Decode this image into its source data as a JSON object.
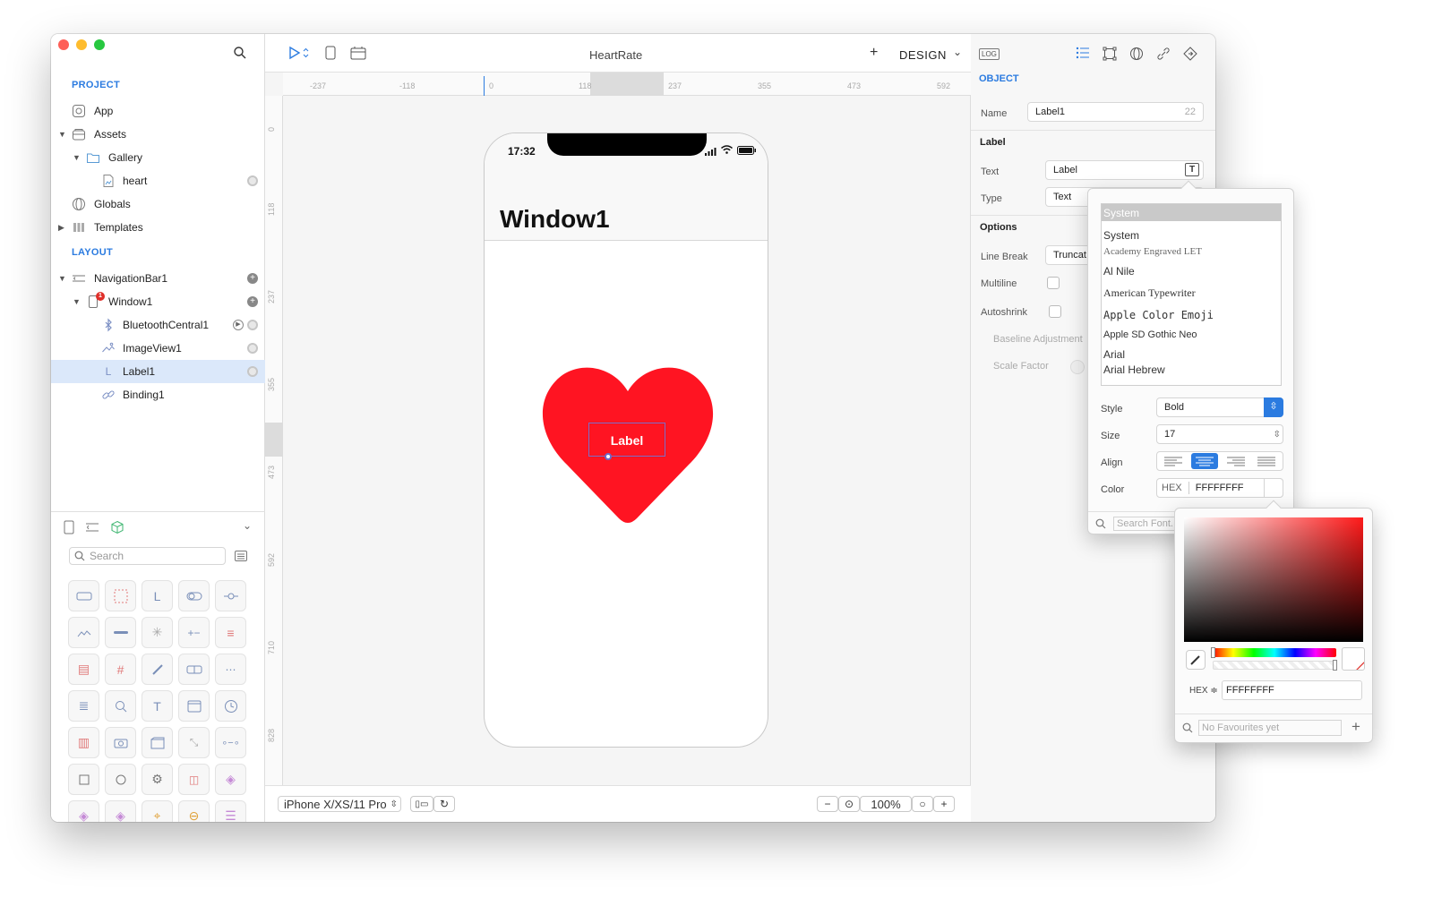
{
  "window_title": "HeartRate",
  "mode": "DESIGN",
  "sidebar": {
    "project_title": "PROJECT",
    "layout_title": "LAYOUT",
    "project_items": [
      "App",
      "Assets",
      "Gallery",
      "heart",
      "Globals",
      "Templates"
    ],
    "layout_items": [
      "NavigationBar1",
      "Window1",
      "BluetoothCentral1",
      "ImageView1",
      "Label1",
      "Binding1"
    ],
    "window_badge": "1",
    "search_placeholder": "Search"
  },
  "rulers": {
    "horizontal": [
      "-237",
      "-118",
      "0",
      "118",
      "237",
      "355",
      "473",
      "592"
    ],
    "vertical": [
      "0",
      "118",
      "237",
      "355",
      "473",
      "592",
      "710",
      "828"
    ]
  },
  "phone": {
    "time": "17:32",
    "nav_title": "Window1",
    "label_text": "Label",
    "heart_color": "#ff1422"
  },
  "bottom_bar": {
    "device": "iPhone X/XS/11 Pro",
    "zoom": "100%",
    "zoom_out": "−",
    "zoom_in": "+"
  },
  "inspector": {
    "log": "LOG",
    "section_object": "OBJECT",
    "name_label": "Name",
    "name_value": "Label1",
    "name_count": "22",
    "section_label": "Label",
    "text_label": "Text",
    "text_value": "Label",
    "type_label": "Type",
    "type_value": "Text",
    "section_options": "Options",
    "line_break_label": "Line Break",
    "line_break_value": "Truncat",
    "multiline_label": "Multiline",
    "autoshrink_label": "Autoshrink",
    "baseline_label": "Baseline Adjustment",
    "scale_label": "Scale Factor"
  },
  "font_popover": {
    "selected": "System",
    "fonts": [
      "System",
      "Academy Engraved LET",
      "Al Nile",
      "American Typewriter",
      "Apple  Color  Emoji",
      "Apple SD Gothic Neo",
      "Arial",
      "Arial Hebrew"
    ],
    "style_label": "Style",
    "style_value": "Bold",
    "size_label": "Size",
    "size_value": "17",
    "align_label": "Align",
    "color_label": "Color",
    "hex_prefix": "HEX",
    "hex_value": "FFFFFFFF",
    "search_placeholder": "Search Font..."
  },
  "color_popover": {
    "hex_label": "HEX ≑",
    "hex_value": "FFFFFFFF",
    "favourites_placeholder": "No Favourites yet",
    "add": "+"
  }
}
